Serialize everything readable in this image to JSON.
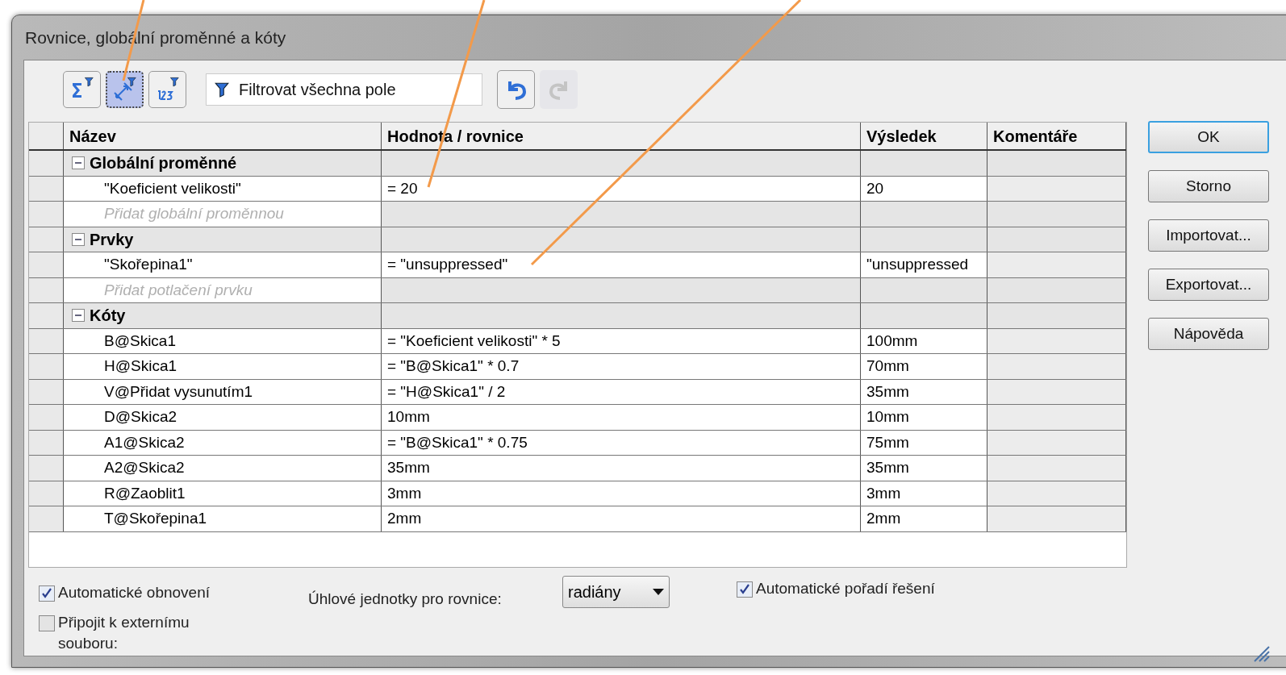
{
  "window": {
    "title": "Rovnice, globální proměnné a kóty"
  },
  "toolbar": {
    "view_buttons": [
      {
        "kind": "equations",
        "selected": false
      },
      {
        "kind": "dimensions",
        "selected": true
      },
      {
        "kind": "ordered",
        "selected": false
      }
    ],
    "filter": {
      "placeholder": "Filtrovat všechna pole"
    },
    "history": [
      {
        "kind": "undo",
        "disabled": false
      },
      {
        "kind": "redo",
        "disabled": true
      }
    ]
  },
  "table": {
    "columns": [
      "Název",
      "Hodnota / rovnice",
      "Výsledek",
      "Komentáře"
    ],
    "rows": [
      {
        "kind": "group",
        "name": "Globální proměnné",
        "expanded": true
      },
      {
        "kind": "item",
        "name": "\"Koeficient velikosti\"",
        "value": "= 20",
        "result": "20"
      },
      {
        "kind": "add",
        "name": "Přidat globální proměnnou"
      },
      {
        "kind": "group",
        "name": "Prvky",
        "expanded": true
      },
      {
        "kind": "item",
        "name": "\"Skořepina1\"",
        "value": "= \"unsuppressed\"",
        "result": "\"unsuppressed"
      },
      {
        "kind": "add",
        "name": "Přidat potlačení prvku"
      },
      {
        "kind": "group",
        "name": "Kóty",
        "expanded": true
      },
      {
        "kind": "item",
        "name": "B@Skica1",
        "value": "= \"Koeficient velikosti\" * 5",
        "result": "100mm"
      },
      {
        "kind": "item",
        "name": "H@Skica1",
        "value": "= \"B@Skica1\" * 0.7",
        "result": "70mm"
      },
      {
        "kind": "item",
        "name": "V@Přidat vysunutím1",
        "value": "= \"H@Skica1\" / 2",
        "result": "35mm"
      },
      {
        "kind": "item",
        "name": "D@Skica2",
        "value": "10mm",
        "result": "10mm"
      },
      {
        "kind": "item",
        "name": "A1@Skica2",
        "value": "= \"B@Skica1\" * 0.75",
        "result": "75mm"
      },
      {
        "kind": "item",
        "name": "A2@Skica2",
        "value": "35mm",
        "result": "35mm"
      },
      {
        "kind": "item",
        "name": "R@Zaoblit1",
        "value": "3mm",
        "result": "3mm"
      },
      {
        "kind": "item",
        "name": "T@Skořepina1",
        "value": "2mm",
        "result": "2mm"
      }
    ]
  },
  "buttons": [
    "OK",
    "Storno",
    "Importovat...",
    "Exportovat...",
    "Nápověda"
  ],
  "options": {
    "auto_rebuild": {
      "label": "Automatické obnovení",
      "checked": true
    },
    "link_external": {
      "label": "Připojit k externímu souboru:",
      "checked": false
    },
    "angle_units": {
      "label": "Úhlové jednotky pro rovnice:",
      "value": "radiány"
    },
    "auto_order": {
      "label": "Automatické pořadí řešení",
      "checked": true
    }
  }
}
